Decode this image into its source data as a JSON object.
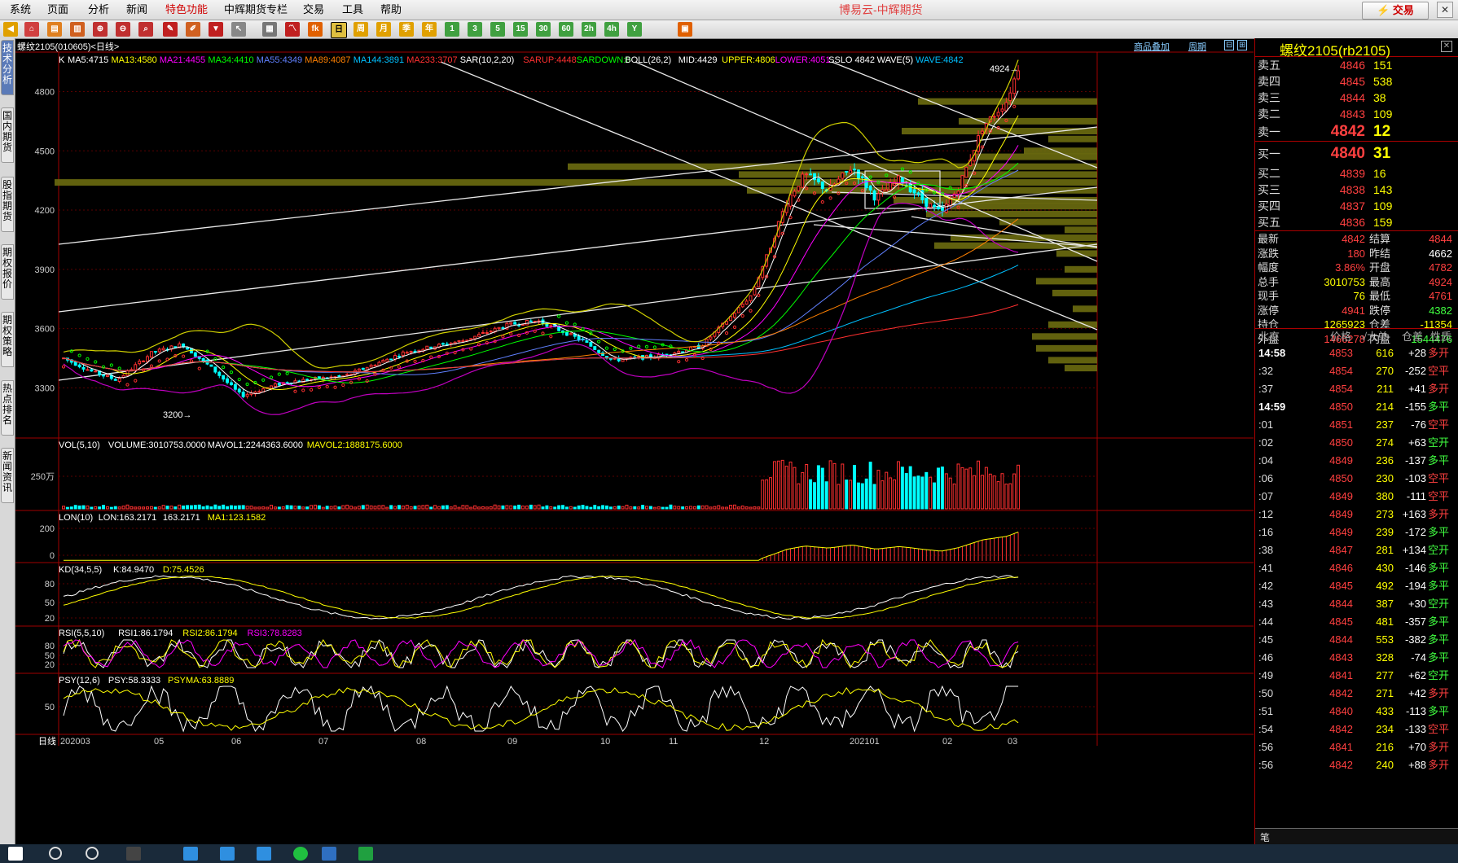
{
  "menu": [
    "系统",
    "页面",
    "分析",
    "新闻",
    "特色功能",
    "中辉期货专栏",
    "交易",
    "工具",
    "帮助"
  ],
  "app_title": "博易云-中辉期货",
  "trade_button": "交易",
  "toolbar_icons": [
    "back-arrow-icon",
    "home-icon",
    "folder-icon",
    "chart-icon",
    "zoom-in-icon",
    "zoom-out-icon",
    "pen-icon",
    "draw-icon",
    "filter-icon",
    "pointer-icon",
    "grid-icon",
    "line-icon",
    "tick-icon",
    "period-day",
    "period-week",
    "period-month",
    "period-quarter",
    "period-year",
    "period-1",
    "period-3",
    "period-5",
    "period-15",
    "period-30",
    "period-60",
    "period-2h",
    "period-4h",
    "period-y",
    "calc-icon"
  ],
  "toolbar_labels": [
    "周",
    "月",
    "季",
    "年",
    "1",
    "3",
    "5",
    "15",
    "30",
    "60",
    "2h",
    "4h",
    "Y",
    "fk"
  ],
  "left_tabs": [
    "技术分析",
    "国内期货",
    "股指期货",
    "期权报价",
    "期权策略",
    "热点排名",
    "新闻资讯"
  ],
  "chart": {
    "symbol_label": "螺纹2105(010605)<日线>",
    "overlay_link": "商品叠加",
    "cycle_link": "周期",
    "main_indicators": [
      {
        "text": "K",
        "color": "#ffffff"
      },
      {
        "text": "MA5:4715",
        "color": "#ffffff"
      },
      {
        "text": "MA13:4580",
        "color": "#ffff00"
      },
      {
        "text": "MA21:4455",
        "color": "#ff00ff"
      },
      {
        "text": "MA34:4410",
        "color": "#00ff00"
      },
      {
        "text": "MA55:4349",
        "color": "#6080ff"
      },
      {
        "text": "MA89:4087",
        "color": "#ff8000"
      },
      {
        "text": "MA144:3891",
        "color": "#00c0ff"
      },
      {
        "text": "MA233:3707",
        "color": "#ff3030"
      },
      {
        "text": "SAR(10,2,20)",
        "color": "#ffffff"
      },
      {
        "text": "SARUP:4448",
        "color": "#ff3030"
      },
      {
        "text": "SARDOWN:0",
        "color": "#00ff00"
      },
      {
        "text": "BOLL(26,2)",
        "color": "#ffffff"
      },
      {
        "text": "MID:4429",
        "color": "#ffffff"
      },
      {
        "text": "UPPER:4806",
        "color": "#ffff00"
      },
      {
        "text": "LOWER:4051",
        "color": "#ff00ff"
      },
      {
        "text": "SSLO 4842",
        "color": "#ffffff"
      },
      {
        "text": "WAVE(5)",
        "color": "#ffffff"
      },
      {
        "text": "WAVE:4842",
        "color": "#00c0ff"
      }
    ],
    "price_axis": [
      "4800",
      "4500",
      "4200",
      "3900",
      "3600",
      "3300"
    ],
    "high_marker": "4924",
    "low_marker": "3200",
    "vol_title": [
      {
        "text": "VOL(5,10)",
        "color": "#ffffff"
      },
      {
        "text": "VOLUME:3010753.0000",
        "color": "#ffffff"
      },
      {
        "text": "MAVOL1:2244363.6000",
        "color": "#ffffff"
      },
      {
        "text": "MAVOL2:1888175.6000",
        "color": "#ffff00"
      }
    ],
    "vol_axis": [
      "250万"
    ],
    "lon_title": [
      {
        "text": "LON(10)",
        "color": "#ffffff"
      },
      {
        "text": "LON:163.2171",
        "color": "#ffffff"
      },
      {
        "text": "163.2171",
        "color": "#ffffff"
      },
      {
        "text": "MA1:123.1582",
        "color": "#ffff00"
      }
    ],
    "lon_axis": [
      "200",
      "0"
    ],
    "kd_title": [
      {
        "text": "KD(34,5,5)",
        "color": "#ffffff"
      },
      {
        "text": "K:84.9470",
        "color": "#ffffff"
      },
      {
        "text": "D:75.4526",
        "color": "#ffff00"
      }
    ],
    "kd_axis": [
      "80",
      "50",
      "20"
    ],
    "rsi_title": [
      {
        "text": "RSI(5,5,10)",
        "color": "#ffffff"
      },
      {
        "text": "RSI1:86.1794",
        "color": "#ffffff"
      },
      {
        "text": "RSI2:86.1794",
        "color": "#ffff00"
      },
      {
        "text": "RSI3:78.8283",
        "color": "#ff00ff"
      }
    ],
    "rsi_axis": [
      "80",
      "50",
      "20"
    ],
    "psy_title": [
      {
        "text": "PSY(12,6)",
        "color": "#ffffff"
      },
      {
        "text": "PSY:58.3333",
        "color": "#ffffff"
      },
      {
        "text": "PSYMA:63.8889",
        "color": "#ffff00"
      }
    ],
    "psy_axis": [
      "50"
    ],
    "period_label": "日线",
    "date_axis": [
      "202003",
      "05",
      "06",
      "07",
      "08",
      "09",
      "10",
      "11",
      "12",
      "202101",
      "02",
      "03"
    ]
  },
  "quote": {
    "title": "螺纹2105(rb2105)",
    "asks": [
      {
        "label": "卖五",
        "price": "4846",
        "vol": "151"
      },
      {
        "label": "卖四",
        "price": "4845",
        "vol": "538"
      },
      {
        "label": "卖三",
        "price": "4844",
        "vol": "38"
      },
      {
        "label": "卖二",
        "price": "4843",
        "vol": "109"
      },
      {
        "label": "卖一",
        "price": "4842",
        "vol": "12"
      }
    ],
    "bids": [
      {
        "label": "买一",
        "price": "4840",
        "vol": "31"
      },
      {
        "label": "买二",
        "price": "4839",
        "vol": "16"
      },
      {
        "label": "买三",
        "price": "4838",
        "vol": "143"
      },
      {
        "label": "买四",
        "price": "4837",
        "vol": "109"
      },
      {
        "label": "买五",
        "price": "4836",
        "vol": "159"
      }
    ],
    "stats": [
      {
        "l1": "最新",
        "v1": "4842",
        "c1": "red",
        "l2": "结算",
        "v2": "4844",
        "c2": "red"
      },
      {
        "l1": "涨跌",
        "v1": "180",
        "c1": "red",
        "l2": "昨结",
        "v2": "4662",
        "c2": "wht"
      },
      {
        "l1": "幅度",
        "v1": "3.86%",
        "c1": "red",
        "l2": "开盘",
        "v2": "4782",
        "c2": "red"
      },
      {
        "l1": "总手",
        "v1": "3010753",
        "c1": "yel",
        "l2": "最高",
        "v2": "4924",
        "c2": "red"
      },
      {
        "l1": "现手",
        "v1": "76",
        "c1": "yel",
        "l2": "最低",
        "v2": "4761",
        "c2": "red"
      },
      {
        "l1": "涨停",
        "v1": "4941",
        "c1": "red",
        "l2": "跌停",
        "v2": "4382",
        "c2": "grn"
      },
      {
        "l1": "持仓",
        "v1": "1265923",
        "c1": "yel",
        "l2": "仓差",
        "v2": "-11354",
        "c2": "yel"
      },
      {
        "l1": "外盘",
        "v1": "1466278",
        "c1": "red",
        "l2": "内盘",
        "v2": "1544476",
        "c2": "grn"
      }
    ],
    "tick_header": [
      "北京",
      "价格",
      "√大单",
      "仓差",
      "性质"
    ],
    "ticks": [
      {
        "t": "14:58",
        "p": "4853",
        "q": "616",
        "d": "+28",
        "n": "多开",
        "c": "red"
      },
      {
        "t": ":32",
        "p": "4854",
        "q": "270",
        "d": "-252",
        "n": "空平",
        "c": "red"
      },
      {
        "t": ":37",
        "p": "4854",
        "q": "211",
        "d": "+41",
        "n": "多开",
        "c": "red"
      },
      {
        "t": "14:59",
        "p": "4850",
        "q": "214",
        "d": "-155",
        "n": "多平",
        "c": "grn"
      },
      {
        "t": ":01",
        "p": "4851",
        "q": "237",
        "d": "-76",
        "n": "空平",
        "c": "red"
      },
      {
        "t": ":02",
        "p": "4850",
        "q": "274",
        "d": "+63",
        "n": "空开",
        "c": "grn"
      },
      {
        "t": ":04",
        "p": "4849",
        "q": "236",
        "d": "-137",
        "n": "多平",
        "c": "grn"
      },
      {
        "t": ":06",
        "p": "4850",
        "q": "230",
        "d": "-103",
        "n": "空平",
        "c": "red"
      },
      {
        "t": ":07",
        "p": "4849",
        "q": "380",
        "d": "-111",
        "n": "空平",
        "c": "red"
      },
      {
        "t": ":12",
        "p": "4849",
        "q": "273",
        "d": "+163",
        "n": "多开",
        "c": "red"
      },
      {
        "t": ":16",
        "p": "4849",
        "q": "239",
        "d": "-172",
        "n": "多平",
        "c": "grn"
      },
      {
        "t": ":38",
        "p": "4847",
        "q": "281",
        "d": "+134",
        "n": "空开",
        "c": "grn"
      },
      {
        "t": ":41",
        "p": "4846",
        "q": "430",
        "d": "-146",
        "n": "多平",
        "c": "grn"
      },
      {
        "t": ":42",
        "p": "4845",
        "q": "492",
        "d": "-194",
        "n": "多平",
        "c": "grn"
      },
      {
        "t": ":43",
        "p": "4844",
        "q": "387",
        "d": "+30",
        "n": "空开",
        "c": "grn"
      },
      {
        "t": ":44",
        "p": "4845",
        "q": "481",
        "d": "-357",
        "n": "多平",
        "c": "grn"
      },
      {
        "t": ":45",
        "p": "4844",
        "q": "553",
        "d": "-382",
        "n": "多平",
        "c": "grn"
      },
      {
        "t": ":46",
        "p": "4843",
        "q": "328",
        "d": "-74",
        "n": "多平",
        "c": "grn"
      },
      {
        "t": ":49",
        "p": "4841",
        "q": "277",
        "d": "+62",
        "n": "空开",
        "c": "grn"
      },
      {
        "t": ":50",
        "p": "4842",
        "q": "271",
        "d": "+42",
        "n": "多开",
        "c": "red"
      },
      {
        "t": ":51",
        "p": "4840",
        "q": "433",
        "d": "-113",
        "n": "多平",
        "c": "grn"
      },
      {
        "t": ":54",
        "p": "4842",
        "q": "234",
        "d": "-133",
        "n": "空平",
        "c": "red"
      },
      {
        "t": ":56",
        "p": "4841",
        "q": "216",
        "d": "+70",
        "n": "多开",
        "c": "red"
      },
      {
        "t": ":56",
        "p": "4842",
        "q": "240",
        "d": "+88",
        "n": "多开",
        "c": "red"
      }
    ],
    "bottom_tab": "笔"
  },
  "colors": {
    "up": "#ff3030",
    "down": "#00ffff",
    "grid": "#8b0000",
    "text": "#cccccc"
  }
}
